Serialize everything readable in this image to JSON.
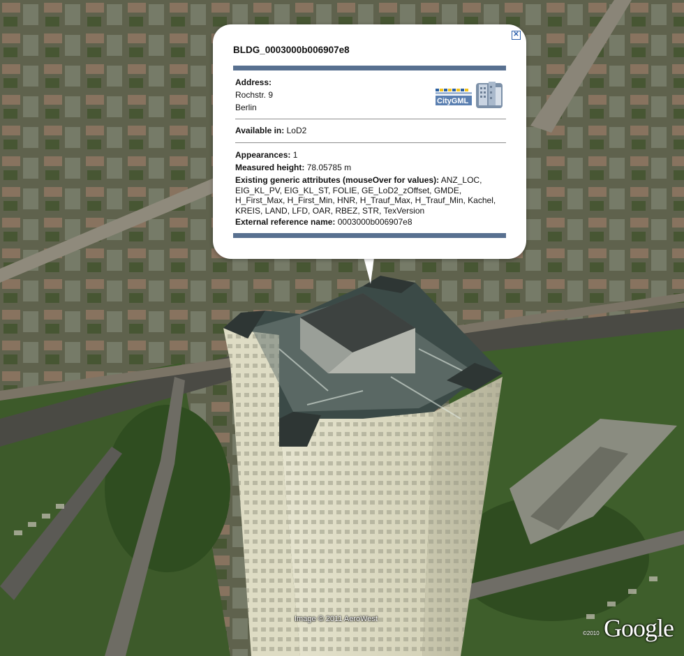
{
  "balloon": {
    "title": "BLDG_0003000b006907e8",
    "close_icon": "close-x-icon",
    "address_label": "Address:",
    "address_street": "Rochstr. 9",
    "address_city": "Berlin",
    "available_label": "Available in:",
    "available_value": "LoD2",
    "appearances_label": "Appearances:",
    "appearances_value": "1",
    "height_label": "Measured height:",
    "height_value": "78.05785 m",
    "attrs_label": "Existing generic attributes (mouseOver for values):",
    "attrs_value": "ANZ_LOC, EIG_KL_PV, EIG_KL_ST, FOLIE, GE_LoD2_zOffset, GMDE, H_First_Max, H_First_Min, HNR, H_Trauf_Max, H_Trauf_Min, Kachel, KREIS, LAND, LFD, OAR, RBEZ, STR, TexVersion",
    "extref_label": "External reference name:",
    "extref_value": "0003000b006907e8",
    "logo_text": "CityGML",
    "bar_color": "#587090"
  },
  "map": {
    "copyright": "Image © 2011 AeroWest",
    "google_logo": "Google",
    "year": "©2010"
  }
}
